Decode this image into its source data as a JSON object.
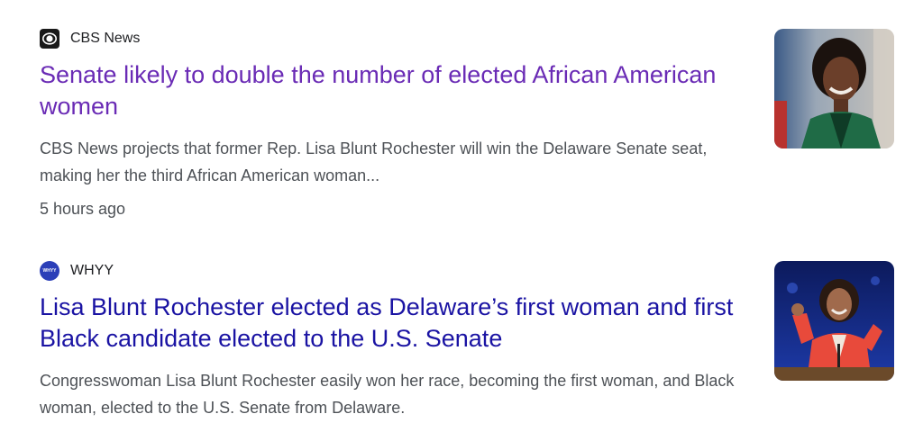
{
  "results": [
    {
      "source": "CBS News",
      "favicon": "cbs-eye-logo",
      "title": "Senate likely to double the number of elected African American women",
      "snippet": "CBS News projects that former Rep. Lisa Blunt Rochester will win the Delaware Senate seat, making her the third African American woman...",
      "time": "5 hours ago",
      "title_color": "#6a2bb5",
      "thumbnail": "photo-woman-smiling-green-jacket"
    },
    {
      "source": "WHYY",
      "favicon_text": "WHYY",
      "title": "Lisa Blunt Rochester elected as Delaware’s first woman and first Black candidate elected to the U.S. Senate",
      "snippet": "Congresswoman Lisa Blunt Rochester easily won her race, becoming the first woman, and Black woman, elected to the U.S. Senate from Delaware.",
      "title_color": "#1a13a3",
      "thumbnail": "photo-woman-speaking-red-jacket"
    }
  ]
}
